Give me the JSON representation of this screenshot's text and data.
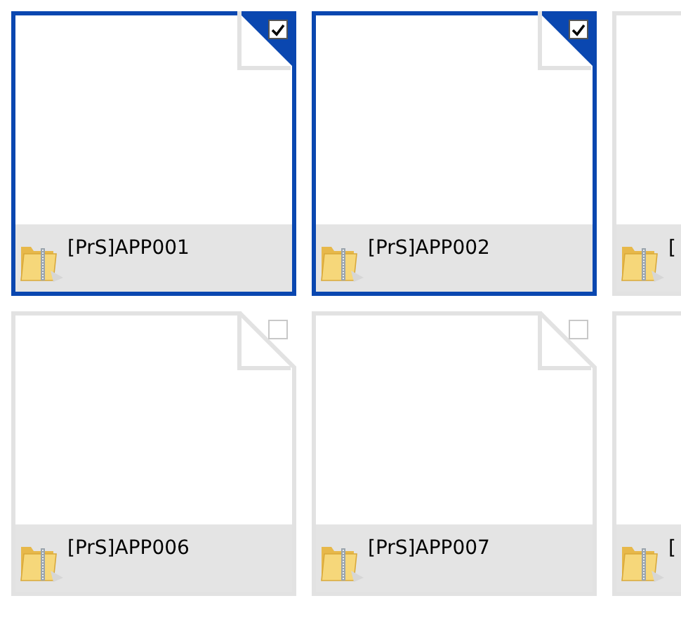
{
  "tiles": [
    {
      "name": "[PrS]APP001",
      "selected": true,
      "checked": true
    },
    {
      "name": "[PrS]APP002",
      "selected": true,
      "checked": true
    },
    {
      "name": "[",
      "selected": false
    },
    {
      "name": "[PrS]APP006",
      "selected": false,
      "checked": false
    },
    {
      "name": "[PrS]APP007",
      "selected": false,
      "checked": false
    },
    {
      "name": "[",
      "selected": false
    }
  ]
}
